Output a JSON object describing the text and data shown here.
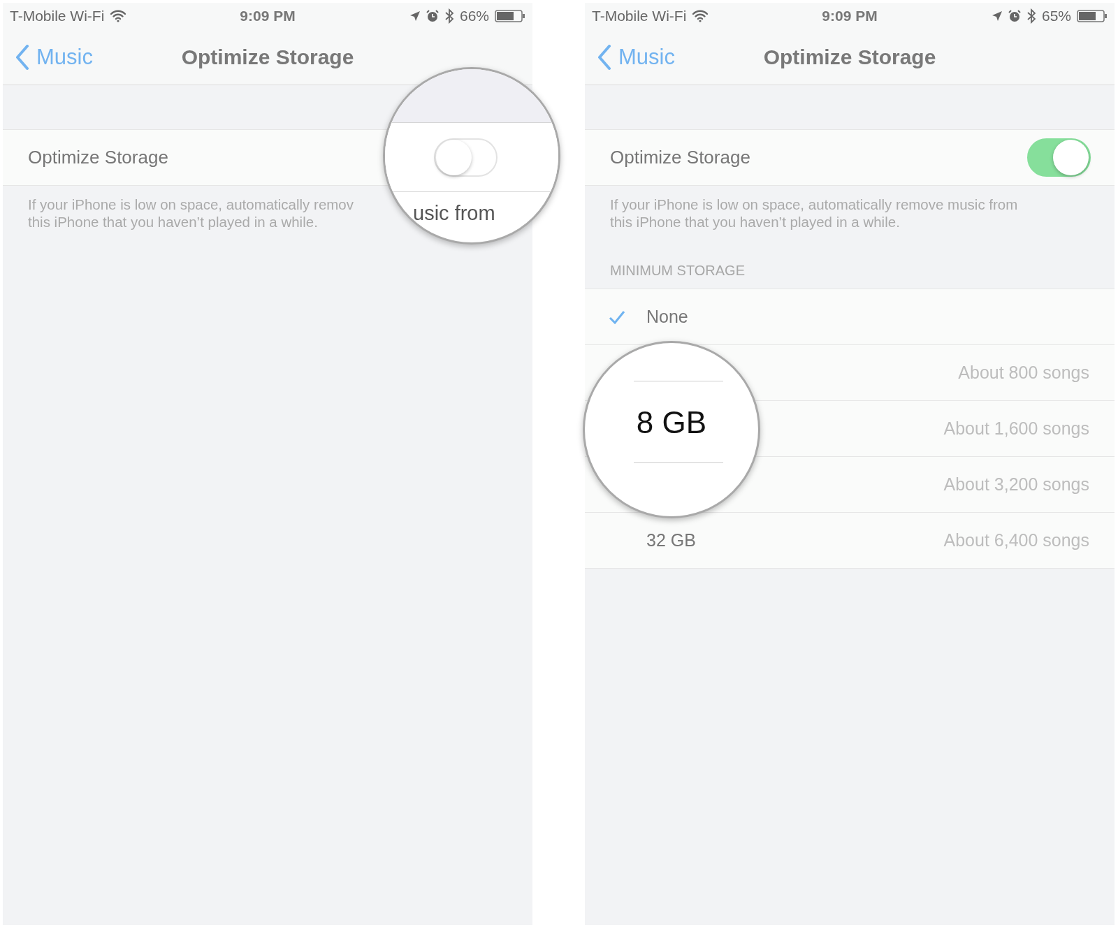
{
  "screens": [
    {
      "status_bar": {
        "carrier": "T-Mobile Wi-Fi",
        "time": "9:09 PM",
        "battery": "66%"
      },
      "nav": {
        "back": "Music",
        "title": "Optimize Storage"
      },
      "setting": {
        "label": "Optimize Storage"
      },
      "footer": "If your iPhone is low on space, automatically remov\nthis iPhone that you haven’t played in a while.",
      "magnifier": {
        "kind": "toggle",
        "on": false,
        "text": "usic from"
      }
    },
    {
      "status_bar": {
        "carrier": "T-Mobile Wi-Fi",
        "time": "9:09 PM",
        "battery": "65%"
      },
      "nav": {
        "back": "Music",
        "title": "Optimize Storage"
      },
      "setting": {
        "label": "Optimize Storage",
        "on": true
      },
      "footer": "If your iPhone is low on space, automatically remove music from\nthis iPhone that you haven’t played in a while.",
      "minimum_storage": {
        "header": "MINIMUM STORAGE",
        "options": [
          {
            "label": "None",
            "selected": true
          },
          {
            "detail": "About 800 songs"
          },
          {
            "detail": "About 1,600 songs"
          },
          {
            "detail": "About 3,200 songs"
          },
          {
            "label": "32 GB",
            "detail": "About 6,400 songs",
            "selected": false
          }
        ]
      },
      "magnifier": {
        "kind": "picker",
        "text": "8 GB"
      }
    }
  ]
}
